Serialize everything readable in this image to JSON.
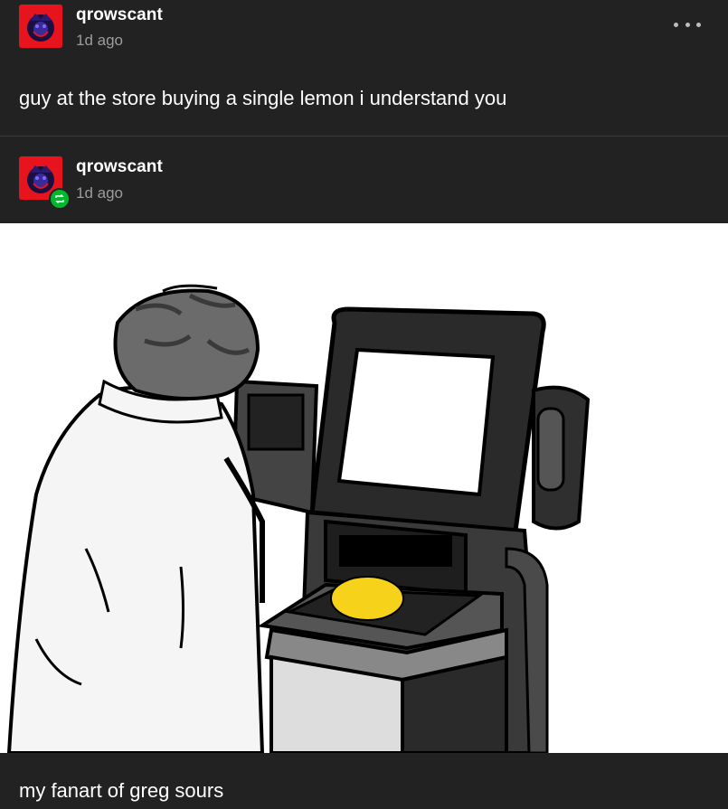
{
  "post": {
    "username": "qrowscant",
    "timestamp": "1d ago",
    "text": "guy at the store buying a single lemon i understand you"
  },
  "reblog": {
    "username": "qrowscant",
    "timestamp": "1d ago",
    "caption": "my fanart of greg sours"
  },
  "colors": {
    "background": "#222222",
    "avatar_bg": "#e8141d",
    "reblog_badge": "#00b82e",
    "lemon": "#f7d21b"
  },
  "icons": [
    "more-icon",
    "reblog-icon"
  ]
}
